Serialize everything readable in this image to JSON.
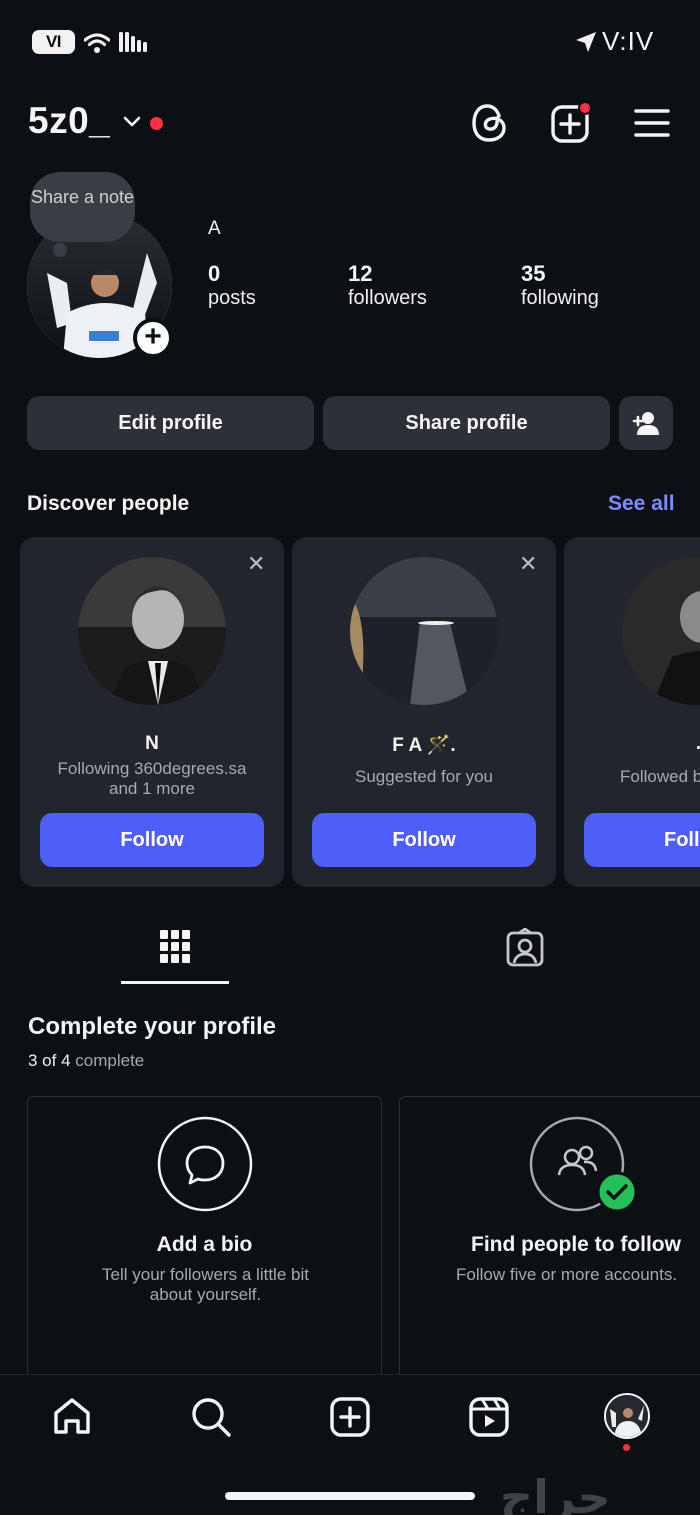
{
  "status_bar": {
    "battery_text": "VI",
    "time": "V:IV",
    "icons": [
      "wifi-icon",
      "signal-icon",
      "location-arrow-icon"
    ]
  },
  "header": {
    "username": "5z0_",
    "icons": [
      "chevron-down-icon",
      "threads-icon",
      "create-post-icon",
      "menu-icon"
    ]
  },
  "profile": {
    "note": "Share a note",
    "display_name": "A",
    "stats": [
      {
        "value": "0",
        "label": "posts"
      },
      {
        "value": "12",
        "label": "followers"
      },
      {
        "value": "35",
        "label": "following"
      }
    ],
    "buttons": {
      "edit": "Edit profile",
      "share": "Share profile"
    }
  },
  "discover": {
    "title": "Discover people",
    "see_all": "See all",
    "cards": [
      {
        "name": "N",
        "subtitle": "Following 360degrees.sa and 1 more",
        "sub_line1": "Following 360degrees.sa",
        "sub_line2": "and 1 more",
        "button": "Follow"
      },
      {
        "name": "F A 🪄.",
        "subtitle": "Suggested for you",
        "button": "Follow"
      },
      {
        "name": "..",
        "subtitle": "Followed b",
        "button": "Foll"
      }
    ]
  },
  "tabs": {
    "icons": [
      "grid-icon",
      "tagged-icon"
    ]
  },
  "complete_profile": {
    "title": "Complete your profile",
    "progress_bold": "3 of 4",
    "progress_rest": "complete",
    "cards": [
      {
        "title": "Add a bio",
        "desc_line1": "Tell your followers a little bit",
        "desc_line2": "about yourself."
      },
      {
        "title": "Find people to follow",
        "desc_line1": "Follow five or more accounts."
      }
    ]
  },
  "tab_bar": {
    "icons": [
      "home-icon",
      "search-icon",
      "create-icon",
      "reels-icon",
      "profile-avatar"
    ]
  },
  "watermark": "حراج",
  "colors": {
    "background": "#0c0f14",
    "card": "#22252c",
    "button_gray": "#2d3036",
    "follow_blue": "#4e5ff7",
    "link_blue": "#7b8cff",
    "notification_red": "#ff2e45",
    "check_green": "#25c05a"
  }
}
